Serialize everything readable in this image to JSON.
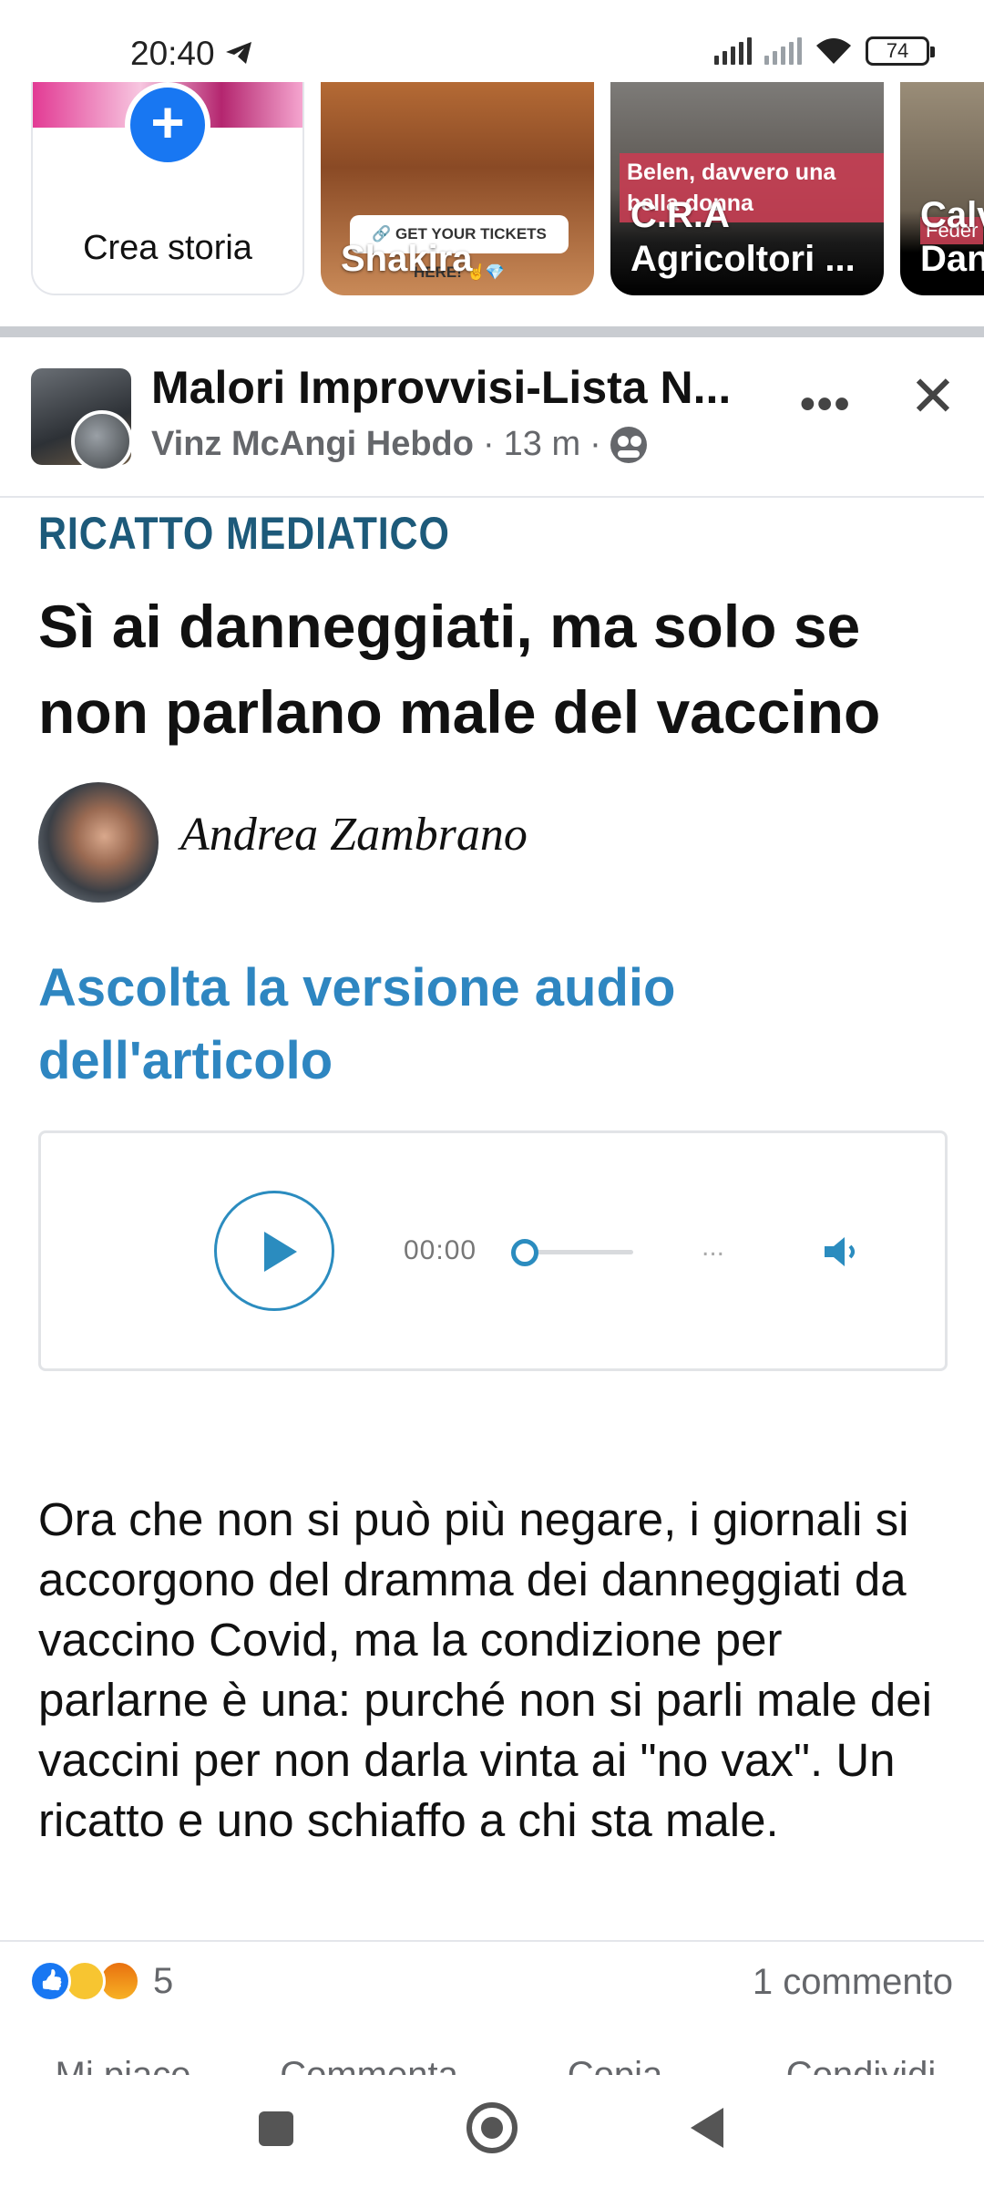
{
  "status_bar": {
    "time": "20:40",
    "battery": "74"
  },
  "stories": {
    "create_label": "Crea storia",
    "items": [
      {
        "name": "Shakira",
        "overlay": "🔗 GET YOUR TICKETS HERE! 🤘💎"
      },
      {
        "name": "C.R.A Agricoltori ...",
        "overlay": "Belen, davvero una bella donna"
      },
      {
        "name": "Calv Dan",
        "overlay": "Feder"
      }
    ]
  },
  "post": {
    "group_name": "Malori Improvvisi-Lista N...",
    "author": "Vinz McAngi Hebdo",
    "time": "13 m",
    "meta_sep": "·",
    "more": "•••",
    "close": "✕"
  },
  "article": {
    "kicker": "RICATTO MEDIATICO",
    "headline": "Sì ai danneggiati, ma solo se non parlano male del vaccino",
    "author": "Andrea Zambrano",
    "audio_heading": "Ascolta la versione audio dell'articolo",
    "player": {
      "time": "00:00",
      "dots": "...",
      "progress": 0
    },
    "body": "Ora che non si può più negare, i giornali si accorgono del dramma dei danneggiati da vaccino Covid, ma la condizione per parlarne è una: purché non si parli male dei vaccini per non darla vinta ai \"no vax\". Un ricatto e uno schiaffo a chi sta male."
  },
  "footer": {
    "reactions": [
      "like",
      "haha",
      "angry"
    ],
    "reaction_count": "5",
    "comments": "1 commento",
    "actions": [
      "Mi piace",
      "Commenta",
      "Copia",
      "Condividi"
    ]
  },
  "colors": {
    "accent_blue": "#1877f2",
    "kicker": "#1d5a7a",
    "audio_link": "#2e86c1",
    "meta_gray": "#65676b"
  }
}
